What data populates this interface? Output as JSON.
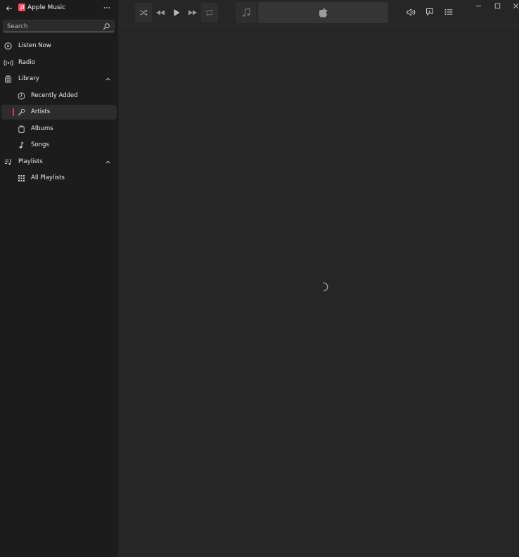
{
  "app": {
    "title": "Apple Music"
  },
  "search": {
    "placeholder": "Search"
  },
  "sidebar": {
    "items": [
      {
        "label": "Listen Now",
        "icon": "play-circle-icon"
      },
      {
        "label": "Radio",
        "icon": "radio-waves-icon"
      },
      {
        "label": "Library",
        "icon": "library-icon",
        "expanded": true
      },
      {
        "label": "Recently Added",
        "icon": "clock-icon"
      },
      {
        "label": "Artists",
        "icon": "microphone-icon",
        "selected": true
      },
      {
        "label": "Albums",
        "icon": "album-icon"
      },
      {
        "label": "Songs",
        "icon": "music-note-icon"
      },
      {
        "label": "Playlists",
        "icon": "playlist-icon",
        "expanded": true
      },
      {
        "label": "All Playlists",
        "icon": "grid-icon"
      }
    ]
  },
  "player": {
    "controls": [
      "shuffle-icon",
      "previous-icon",
      "play-icon",
      "next-icon",
      "repeat-icon"
    ]
  },
  "colors": {
    "accent": "#fa2d48",
    "sidebar_bg": "#1c1c1c",
    "content_bg": "#262626"
  }
}
